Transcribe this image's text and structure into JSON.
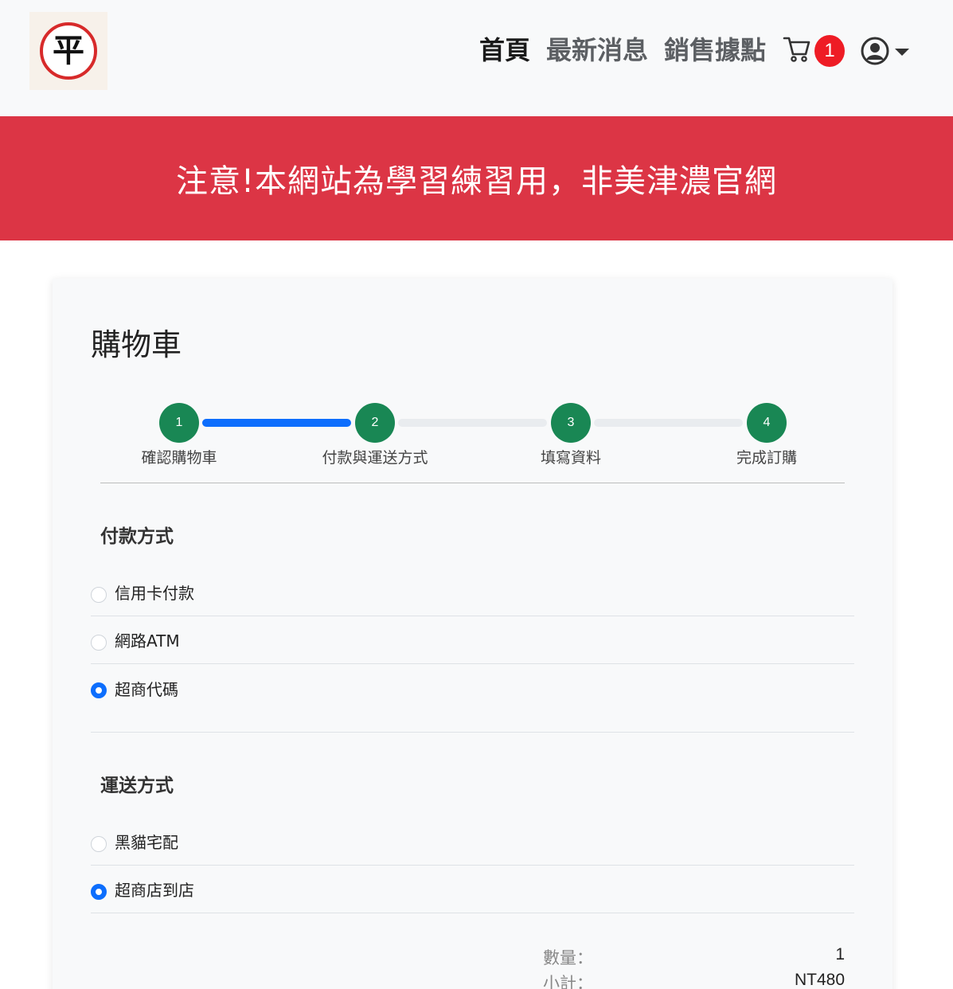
{
  "nav": {
    "logo_char": "平",
    "links": [
      "首頁",
      "最新消息",
      "銷售據點"
    ],
    "cart_count": "1"
  },
  "banner": {
    "text": "注意!本網站為學習練習用，非美津濃官網"
  },
  "card": {
    "title": "購物車",
    "steps": [
      {
        "num": "1",
        "label": "確認購物車"
      },
      {
        "num": "2",
        "label": "付款與運送方式"
      },
      {
        "num": "3",
        "label": "填寫資料"
      },
      {
        "num": "4",
        "label": "完成訂購"
      }
    ],
    "payment": {
      "title": "付款方式",
      "options": [
        "信用卡付款",
        "網路ATM",
        "超商代碼"
      ],
      "selected": "超商代碼"
    },
    "shipping": {
      "title": "運送方式",
      "options": [
        "黑貓宅配",
        "超商店到店"
      ],
      "selected": "超商店到店"
    },
    "summary": {
      "qty_label": "數量：",
      "qty_value": "1",
      "subtotal_label": "小計：",
      "subtotal_value": "NT480"
    }
  },
  "colors": {
    "banner": "#dc3545",
    "step": "#198754",
    "progress": "#0d6efd",
    "badge": "#ee1c25"
  }
}
